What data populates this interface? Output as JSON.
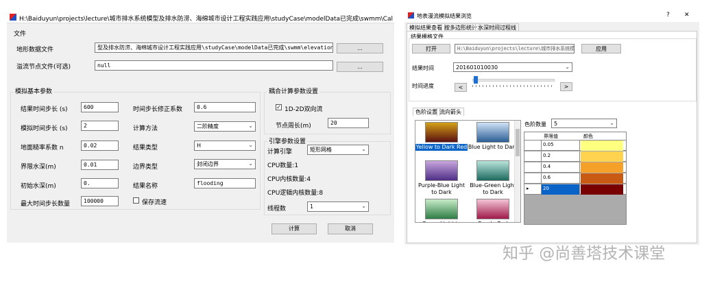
{
  "left": {
    "title": "H:\\Baiduyun\\projects\\lecture\\城市排水系统模型及排水防涝、海绵城市设计工程实践应用\\studyCase\\modelData已完成\\swmm\\CalSpace\\conf",
    "file_group": "文件",
    "terrain_label": "地形数据文件",
    "terrain_value": "型及排水防涝、海绵城市设计工程实践应用\\studyCase\\modelData已完成\\swmm\\elevation.tif",
    "overflow_label": "溢流节点文件(可选)",
    "overflow_value": "null",
    "browse1": "...",
    "browse2": "...",
    "sim_group": "模拟基本参数",
    "p1_label": "结果时间步长 (s)",
    "p1_value": "600",
    "p2_label": "模拟时间步长 (s)",
    "p2_value": "2",
    "p3_label": "地面糙率系数 n",
    "p3_value": "0.02",
    "p4_label": "界限水深(m)",
    "p4_value": "0.01",
    "p5_label": "初始水深(m)",
    "p5_value": "0.",
    "p6_label": "最大时间步长数量",
    "p6_value": "100000",
    "q1_label": "时间步长修正系数",
    "q1_value": "0.6",
    "q2_label": "计算方法",
    "q2_value": "二阶精度",
    "q3_label": "结果类型",
    "q3_value": "H",
    "q4_label": "边界类型",
    "q4_value": "封闭边界",
    "q5_label": "结果名称",
    "q5_value": "flooding",
    "save_flow": "保存流速",
    "couple_group": "耦合计算参数设置",
    "couple_check": "1D-2D双向流",
    "perimeter_label": "节点周长(m)",
    "perimeter_value": "20",
    "engine_group": "引擎参数设置",
    "engine_label": "计算引擎",
    "engine_value": "矩形网格",
    "cpu_count": "CPU数量:1",
    "cpu_cores": "CPU内核数量:4",
    "cpu_logical": "CPU逻辑内核数量:8",
    "threads_label": "线程数",
    "threads_value": "1",
    "compute_btn": "计算",
    "cancel_btn": "取消"
  },
  "right": {
    "title": "地表漫流模拟结果浏览",
    "help": "?",
    "close": "✕",
    "tabs": [
      "模拟结果查看",
      "按多边形统计",
      "水深时间过程线"
    ],
    "raster_group": "结果栅格文件",
    "open_btn": "打开",
    "path": "H:\\Baiduyun\\projects\\lecture\\城市排水系统模型及排",
    "apply_btn": "应用",
    "time_label": "结果时间",
    "time_value": "201601010030",
    "progress_label": "时间进度",
    "progress": 0.02,
    "prev": "<",
    "next": ">",
    "subtabs": [
      "色阶设置",
      "流向箭头"
    ],
    "colormaps": [
      {
        "name": "Yellow to Dark Red",
        "selected": true,
        "c1": "#d4a017",
        "c2": "#5a1010"
      },
      {
        "name": "Blue Light to Dark",
        "selected": false,
        "c1": "#cfe1f5",
        "c2": "#2b5f95"
      },
      {
        "name": "Purple-Blue Light to Dark",
        "selected": false,
        "c1": "#c9a6de",
        "c2": "#4e2f86"
      },
      {
        "name": "Blue-Green Light to Dark",
        "selected": false,
        "c1": "#b9e4dc",
        "c2": "#1d6a5e"
      },
      {
        "name": "Green Light to",
        "selected": false,
        "c1": "#c8ecc8",
        "c2": "#2f7d46"
      },
      {
        "name": "Purple-Red",
        "selected": false,
        "c1": "#f3c4d6",
        "c2": "#a01a4a"
      }
    ],
    "levels_label": "色阶数量",
    "levels_value": "5",
    "table_headers": [
      "界限值",
      "颜色"
    ],
    "table_rows": [
      {
        "value": "0.05",
        "color": "#ffff80"
      },
      {
        "value": "0.2",
        "color": "#ffd250"
      },
      {
        "value": "0.4",
        "color": "#f5a028"
      },
      {
        "value": "0.6",
        "color": "#c85a14"
      },
      {
        "value": "20",
        "color": "#780000"
      }
    ],
    "watermark": "知乎 @尚善塔技术课堂"
  }
}
